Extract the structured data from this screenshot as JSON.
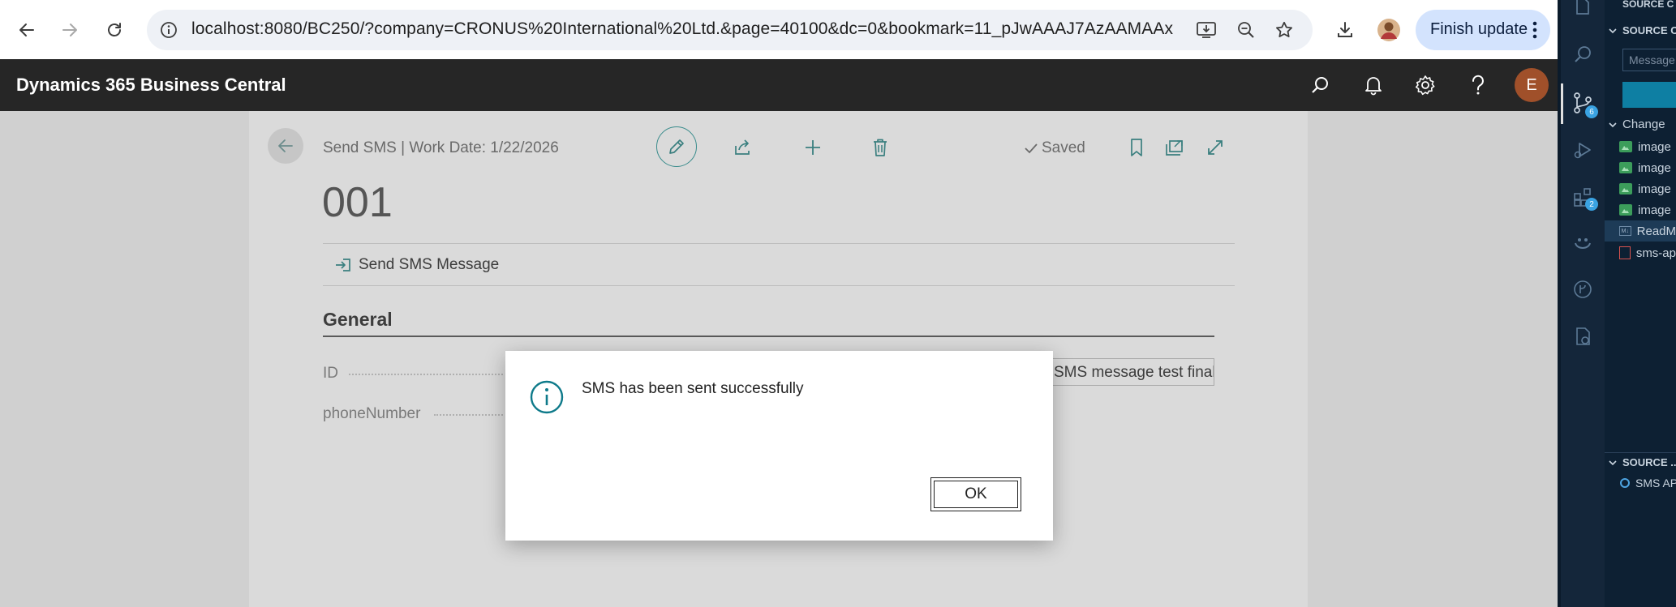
{
  "browser": {
    "url": "localhost:8080/BC250/?company=CRONUS%20International%20Ltd.&page=40100&dc=0&bookmark=11_pJwAAAJ7AzAAMAAx",
    "finish_update_label": "Finish update"
  },
  "app": {
    "title": "Dynamics 365 Business Central",
    "avatar_initial": "E"
  },
  "page": {
    "caption": "Send SMS | Work Date: 1/22/2026",
    "status": "Saved",
    "record_no": "001",
    "action_label": "Send SMS Message",
    "section_title": "General",
    "fields": [
      {
        "label": "ID",
        "value": "SMS message test final"
      },
      {
        "label": "phoneNumber",
        "value": ""
      }
    ]
  },
  "dialog": {
    "message": "SMS has been sent successfully",
    "ok_label": "OK"
  },
  "vscode": {
    "top_header": "SOURCE C",
    "changes_header": "SOURCE C",
    "message_placeholder": "Message",
    "changes_label": "Change",
    "files": [
      {
        "name": "image",
        "kind": "image"
      },
      {
        "name": "image",
        "kind": "image"
      },
      {
        "name": "image",
        "kind": "image"
      },
      {
        "name": "image",
        "kind": "image"
      },
      {
        "name": "ReadM",
        "kind": "markdown"
      },
      {
        "name": "sms-ap",
        "kind": "json"
      }
    ],
    "graph_header": "SOURCE ...",
    "graph_item": "SMS AP",
    "badges": {
      "scm": "6",
      "extensions": "2"
    }
  },
  "colors": {
    "accent_teal": "#3a8c8c",
    "bc_bar": "#262626",
    "avatar": "#a0502a",
    "chrome_pill": "#d3e3fd"
  }
}
